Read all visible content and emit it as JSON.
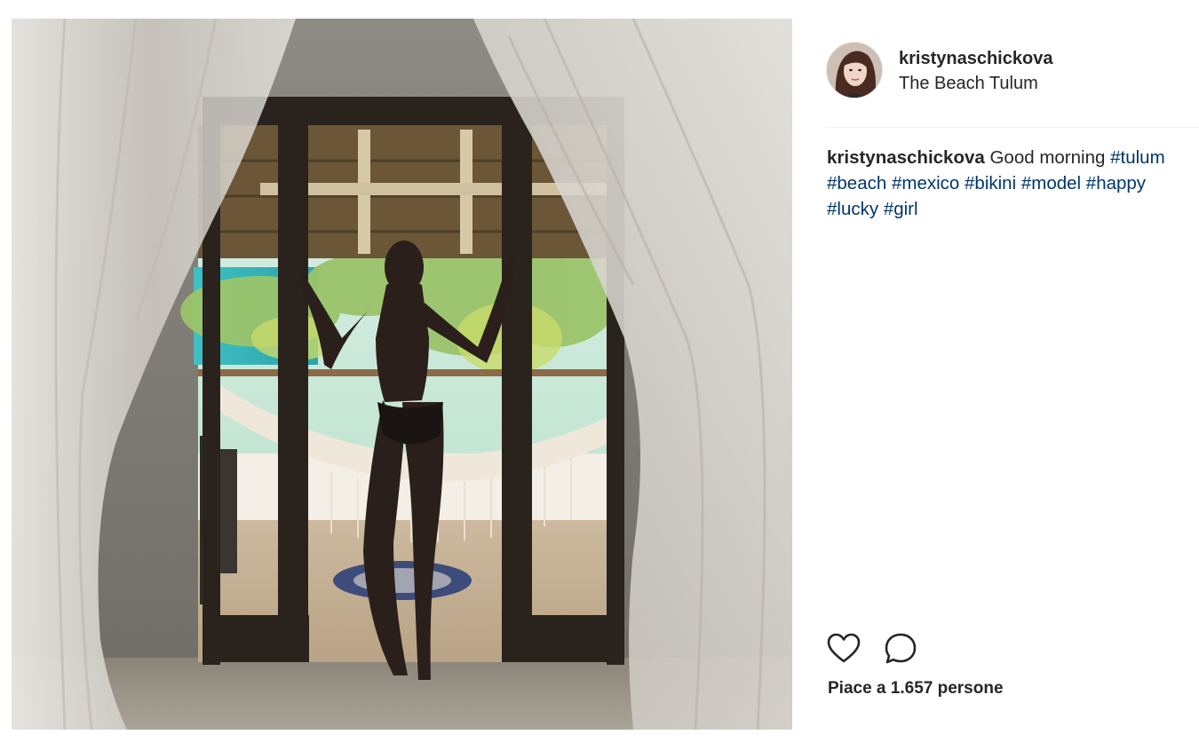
{
  "post": {
    "username": "kristynaschickova",
    "location": "The Beach Tulum",
    "caption": {
      "username": "kristynaschickova",
      "text": "Good morning",
      "hashtags": [
        "#tulum",
        "#beach",
        "#mexico",
        "#bikini",
        "#model",
        "#happy",
        "#lucky",
        "#girl"
      ]
    },
    "likes_text": "Piace a 1.657 persone"
  },
  "icons": {
    "like": "heart-outline-icon",
    "comment": "speech-bubble-icon"
  },
  "colors": {
    "text": "#262626",
    "hashtag": "#003569",
    "divider": "#efefef"
  }
}
